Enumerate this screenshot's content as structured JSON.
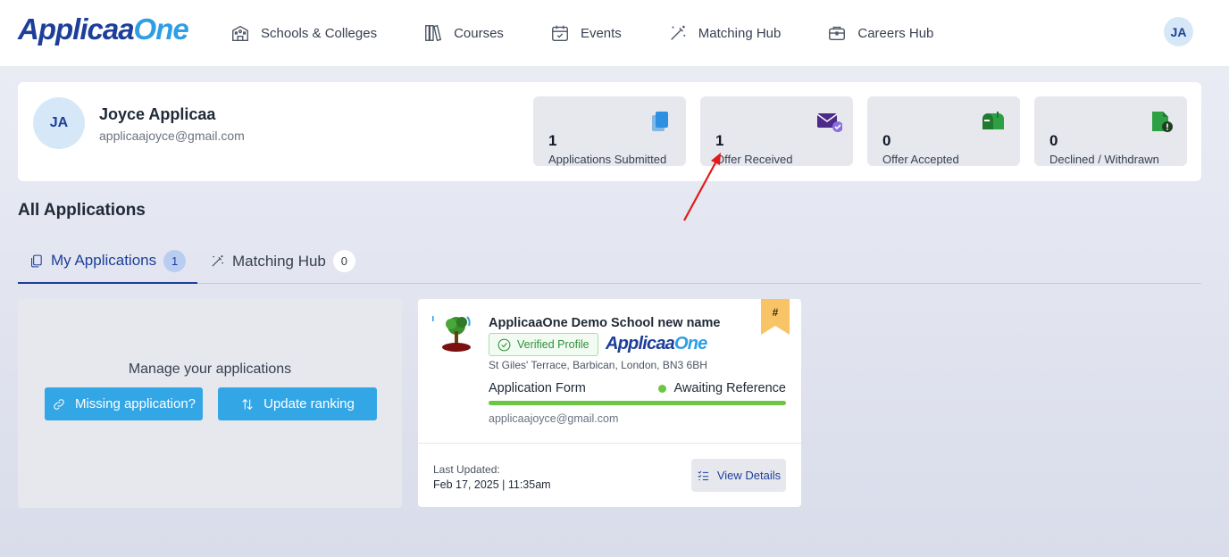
{
  "brand": {
    "logo_a": "Applicaa",
    "logo_b": "One"
  },
  "nav": {
    "items": [
      {
        "label": "Schools & Colleges",
        "icon": "school-icon"
      },
      {
        "label": "Courses",
        "icon": "books-icon"
      },
      {
        "label": "Events",
        "icon": "calendar-check-icon"
      },
      {
        "label": "Matching Hub",
        "icon": "magic-wand-icon"
      },
      {
        "label": "Careers Hub",
        "icon": "briefcase-icon"
      }
    ],
    "avatar_initials": "JA"
  },
  "profile": {
    "initials": "JA",
    "name": "Joyce Applicaa",
    "email": "applicaajoyce@gmail.com"
  },
  "stats": [
    {
      "value": "1",
      "label": "Applications Submitted",
      "icon": "documents-icon",
      "color": "#2f8fe0"
    },
    {
      "value": "1",
      "label": "Offer Received",
      "icon": "envelope-check-icon",
      "color": "#4b2a8a"
    },
    {
      "value": "0",
      "label": "Offer Accepted",
      "icon": "mailbox-icon",
      "color": "#2ea043"
    },
    {
      "value": "0",
      "label": "Declined / Withdrawn",
      "icon": "document-alert-icon",
      "color": "#2ea043"
    }
  ],
  "section_title": "All Applications",
  "tabs": [
    {
      "label": "My Applications",
      "count": "1",
      "icon": "copy-icon"
    },
    {
      "label": "Matching Hub",
      "count": "0",
      "icon": "magic-wand-icon"
    }
  ],
  "manage": {
    "title": "Manage your applications",
    "missing_btn": "Missing application?",
    "ranking_btn": "Update ranking"
  },
  "application": {
    "school_name": "ApplicaaOne Demo School new name",
    "verified_label": "Verified Profile",
    "brand_a": "Applicaa",
    "brand_b": "One",
    "address": "St Giles' Terrace, Barbican, London, BN3 6BH",
    "form_label": "Application Form",
    "status": "Awaiting Reference",
    "progress": 1.0,
    "email": "applicaajoyce@gmail.com",
    "last_updated_label": "Last Updated:",
    "last_updated_value": "Feb 17, 2025 | 11:35am",
    "view_btn": "View Details",
    "ribbon": "#"
  },
  "colors": {
    "brand_dark": "#1d3f9a",
    "brand_light": "#2f9ee4",
    "button_blue": "#33a6e6",
    "status_green": "#6cc644",
    "ribbon": "#f8c466",
    "annotation_arrow": "#e01b1b"
  }
}
